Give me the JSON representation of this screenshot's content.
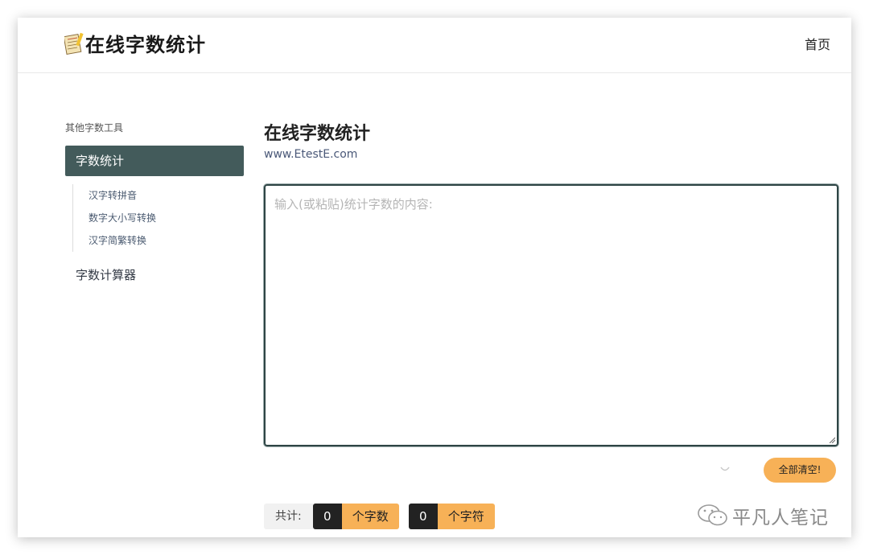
{
  "header": {
    "logo_text": "在线字数统计",
    "home_label": "首页"
  },
  "sidebar": {
    "heading": "其他字数工具",
    "active_item": "字数统计",
    "sub_items": [
      "汉字转拼音",
      "数字大小写转换",
      "汉字简繁转换"
    ],
    "other_item": "字数计算器"
  },
  "main": {
    "title": "在线字数统计",
    "subtitle": "www.EtestE.com",
    "input_placeholder": "输入(或粘贴)统计字数的内容:",
    "input_value": "",
    "clear_label": "全部清空!"
  },
  "stats": {
    "label": "共计:",
    "chars_count": "0",
    "chars_unit": "个字数",
    "symbols_count": "0",
    "symbols_unit": "个字符"
  },
  "watermark": {
    "text": "平凡人笔记"
  },
  "colors": {
    "sidebar_active_bg": "#435b5b",
    "accent_orange": "#f7b157",
    "count_bg": "#222222"
  }
}
